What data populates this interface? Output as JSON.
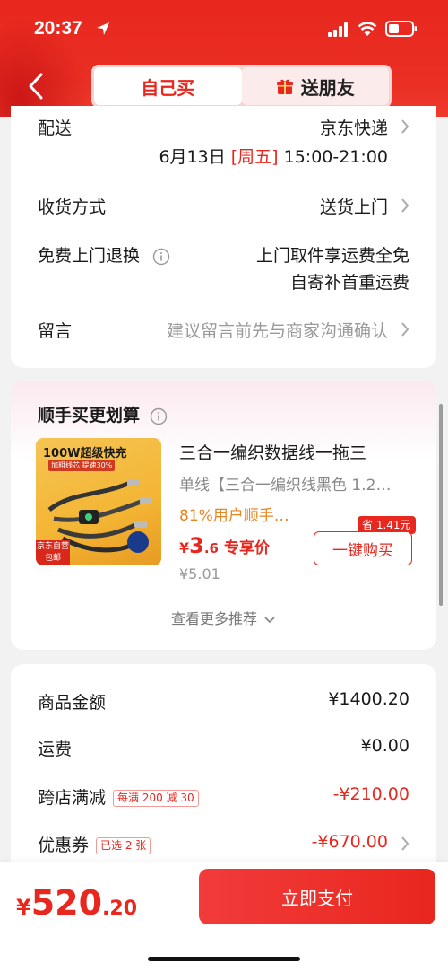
{
  "status_bar": {
    "time": "20:37"
  },
  "header": {
    "tabs": [
      {
        "label": "自己买",
        "active": true
      },
      {
        "label": "送朋友",
        "active": false
      }
    ]
  },
  "delivery": {
    "delivery_label": "配送",
    "delivery_value": "京东快递",
    "date": "6月13日",
    "weekday": "[周五]",
    "time_window": "15:00-21:00",
    "receive_label": "收货方式",
    "receive_value": "送货上门",
    "return_label": "免费上门退换",
    "return_line1": "上门取件享运费全免",
    "return_line2": "自寄补首重运费",
    "note_label": "留言",
    "note_placeholder": "建议留言前先与商家沟通确认"
  },
  "recommend": {
    "title": "顺手买更划算",
    "product": {
      "image_title": "100W超级快充",
      "image_sub": "加粗线芯 提速30%",
      "image_badge": "京东自营 包邮",
      "name": "三合一编织数据线一拖三",
      "spec": "单线【三合一编织线黑色 1.2…",
      "percent": "81%用户顺手…",
      "price_symbol": "¥",
      "price_int": "3",
      "price_dec": ".6",
      "price_tag": "专享价",
      "original_price": "¥5.01",
      "save": "省 1.41元",
      "buy_label": "一键购买"
    },
    "more_label": "查看更多推荐"
  },
  "summary": {
    "items": [
      {
        "label": "商品金额",
        "value": "¥1400.20"
      },
      {
        "label": "运费",
        "value": "¥0.00"
      },
      {
        "label": "跨店满减",
        "pill": "每满 200 减 30",
        "value": "-¥210.00"
      },
      {
        "label": "优惠券",
        "pill": "已选 2 张",
        "value": "-¥670.00"
      }
    ]
  },
  "footer": {
    "total_symbol": "¥",
    "total_int": "520",
    "total_dec": ".20",
    "pay_label": "立即支付"
  },
  "colors": {
    "brand_red": "#e8271e",
    "orange": "#e8861e"
  }
}
